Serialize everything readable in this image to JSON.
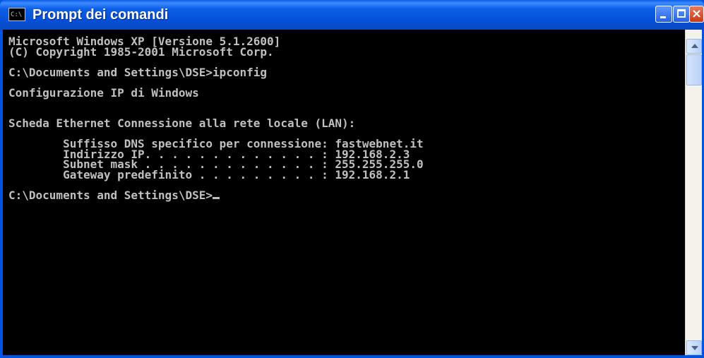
{
  "window": {
    "title": "Prompt dei comandi",
    "icon": "console-icon",
    "icon_text": "C:\\"
  },
  "controls": {
    "minimize": "minimize-icon",
    "maximize": "maximize-icon",
    "close": "close-icon",
    "close_glyph": "×"
  },
  "console": {
    "lines": [
      "Microsoft Windows XP [Versione 5.1.2600]",
      "(C) Copyright 1985-2001 Microsoft Corp.",
      "",
      "C:\\Documents and Settings\\DSE>ipconfig",
      "",
      "Configurazione IP di Windows",
      "",
      "",
      "Scheda Ethernet Connessione alla rete locale (LAN):",
      "",
      "        Suffisso DNS specifico per connessione: fastwebnet.it",
      "        Indirizzo IP. . . . . . . . . . . . . : 192.168.2.3",
      "        Subnet mask . . . . . . . . . . . . . : 255.255.255.0",
      "        Gateway predefinito . . . . . . . . . : 192.168.2.1",
      ""
    ],
    "prompt": "C:\\Documents and Settings\\DSE>"
  },
  "colors": {
    "console_bg": "#000000",
    "console_fg": "#c0c0c0",
    "titlebar": "#0054e3"
  }
}
